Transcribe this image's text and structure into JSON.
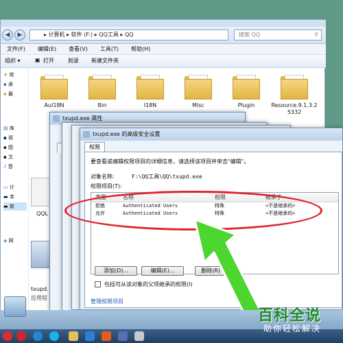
{
  "explorer": {
    "breadcrumb": [
      "计算机",
      "软件 (F:)",
      "QQ工具",
      "QQ"
    ],
    "search_placeholder": "搜索 QQ",
    "menu": [
      "文件(F)",
      "编辑(E)",
      "查看(V)",
      "工具(T)",
      "帮助(H)"
    ],
    "toolbar": {
      "organize": "组织 ▾",
      "open": "打开",
      "burn": "刻录",
      "new_folder": "新建文件夹"
    },
    "sidebar": [
      "收",
      "桌",
      "最",
      "库",
      "视",
      "图",
      "文",
      "音",
      "计",
      "本",
      "软",
      "网"
    ],
    "folders": [
      {
        "label": "AuI18N"
      },
      {
        "label": "Bin"
      },
      {
        "label": "I18N"
      },
      {
        "label": "Misc"
      },
      {
        "label": "Plugin"
      },
      {
        "label": "Resource.9.1.3.25332"
      }
    ],
    "bottom_items": [
      "QQL",
      "txupd.",
      "应用程"
    ]
  },
  "props_dialog": {
    "title": "txupd.exe 属性",
    "tab_clipped": "常"
  },
  "adv_dialog": {
    "title": "txupd.exe 的高级安全设置",
    "tab": "权限",
    "instruction": "要查看或编辑权限项目的详细信息，请选择该项目并单击\"编辑\"。",
    "object_name_label": "对象名称:",
    "object_name_value": "F:\\QQ工具\\QQ\\txupd.exe",
    "entries_label": "权限项目(T):",
    "columns": [
      "类型",
      "名称",
      "权限",
      "继承于"
    ],
    "rows": [
      {
        "type": "拒绝",
        "name": "Authenticated Users",
        "perm": "特殊",
        "inherit": "<不是继承的>"
      },
      {
        "type": "允许",
        "name": "Authenticated Users",
        "perm": "特殊",
        "inherit": "<不是继承的>"
      }
    ],
    "buttons": {
      "add": "添加(D)...",
      "edit": "编辑(E)...",
      "delete": "删除(R)"
    },
    "checkbox_label": "包括可从该对象的父项继承的权限(I)",
    "manage_link": "管理权限项目"
  },
  "watermark": {
    "title": "百科全说",
    "subtitle": "助你轻松解决"
  },
  "colors": {
    "annotation_red": "#e0232b",
    "arrow_green": "#4cd62f",
    "watermark_green": "#1f8b2c"
  }
}
